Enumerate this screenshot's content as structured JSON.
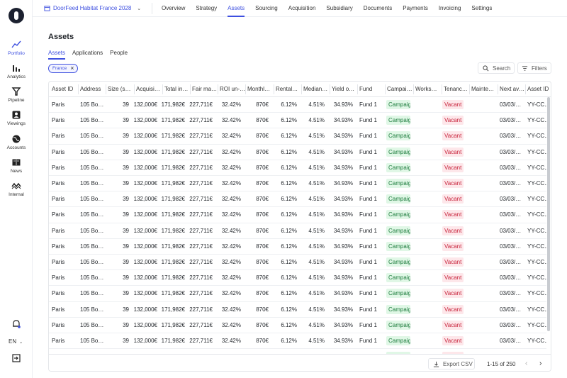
{
  "sidebar": {
    "items": [
      {
        "label": "Portfolio",
        "icon": "trend-line-icon",
        "active": true
      },
      {
        "label": "Analytics",
        "icon": "bar-chart-icon",
        "active": false
      },
      {
        "label": "Pipeline",
        "icon": "funnel-icon",
        "active": false
      },
      {
        "label": "Viewings",
        "icon": "person-card-icon",
        "active": false
      },
      {
        "label": "Accounts",
        "icon": "globe-icon",
        "active": false
      },
      {
        "label": "News",
        "icon": "book-icon",
        "active": false
      },
      {
        "label": "Internal",
        "icon": "wave-icon",
        "active": false
      }
    ],
    "language": "EN"
  },
  "header": {
    "project": "DoorFeed Habitat France 2028",
    "tabs": [
      "Overview",
      "Strategy",
      "Assets",
      "Sourcing",
      "Acquisition",
      "Subsidiary",
      "Documents",
      "Payments",
      "Invoicing",
      "Settings"
    ],
    "active_tab": "Assets"
  },
  "main": {
    "title": "Assets",
    "subtabs": [
      "Assets",
      "Applications",
      "People"
    ],
    "filter_chip": "France",
    "search_label": "Search",
    "filters_label": "Filters"
  },
  "table": {
    "columns": [
      "Asset ID",
      "Address",
      "Size (s…",
      "Acquisi…",
      "Total in…",
      "Fair ma…",
      "ROI un-…",
      "Monthl…",
      "Rental…",
      "Median…",
      "Yield o…",
      "Fund",
      "Campai…",
      "Works…",
      "Tenanc…",
      "Mainte…",
      "Next av…",
      "Asset ID"
    ],
    "row": {
      "asset_id": "Paris",
      "address": "105 Bo…",
      "size": "39",
      "acquisition": "132,000€",
      "total_investment": "171,982€",
      "fair_market": "227,711€",
      "roi": "32.42%",
      "monthly": "870€",
      "rental": "6.12%",
      "median": "4.51%",
      "yield": "34.93%",
      "fund": "Fund 1",
      "campaign": "Campaig",
      "tenancy": "Vacant",
      "next_available": "03/03/…",
      "asset_id2": "YY-CC…"
    },
    "row_count": 17,
    "colors": {
      "campaign_bg": "#e0f7e6",
      "campaign_fg": "#1a7a3a",
      "vacant_bg": "#fde7ea",
      "vacant_fg": "#c8243c"
    }
  },
  "footer": {
    "export_label": "Export CSV",
    "pagination": "1-15 of 250"
  }
}
